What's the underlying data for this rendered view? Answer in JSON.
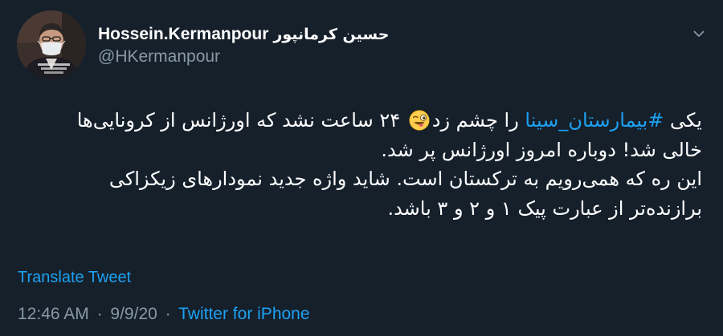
{
  "author": {
    "display_name_latin": "Hossein.Kermanpour",
    "display_name_persian": "حسین کرمانپور",
    "handle": "@HKermanpour"
  },
  "tweet": {
    "line1_prefix": "یکی ",
    "hashtag": "#بیمارستان_سینا",
    "line1_middle": " را چشم زد",
    "line1_suffix": " ۲۴ ساعت نشد که اورژانس از کرونایی‌ها",
    "line2": "خالی شد! دوباره امروز اورژانس پر شد.",
    "line3": "این ره که همی‌رویم به ترکستان است. شاید واژه جدید نمودارهای زیکزاکی",
    "line4": "برازنده‌تر از عبارت پیک ۱ و ۲ و ۳ باشد.",
    "emoji": "winking-face-with-tongue"
  },
  "actions": {
    "translate_label": "Translate Tweet"
  },
  "meta": {
    "time": "12:46 AM",
    "date": "9/9/20",
    "separator": "·",
    "source": "Twitter for iPhone"
  },
  "colors": {
    "background": "#15202b",
    "primary_text": "#ffffff",
    "secondary_text": "#8899a6",
    "accent": "#1da1f2"
  },
  "icons": {
    "menu": "chevron-down-icon",
    "avatar": "avatar"
  }
}
